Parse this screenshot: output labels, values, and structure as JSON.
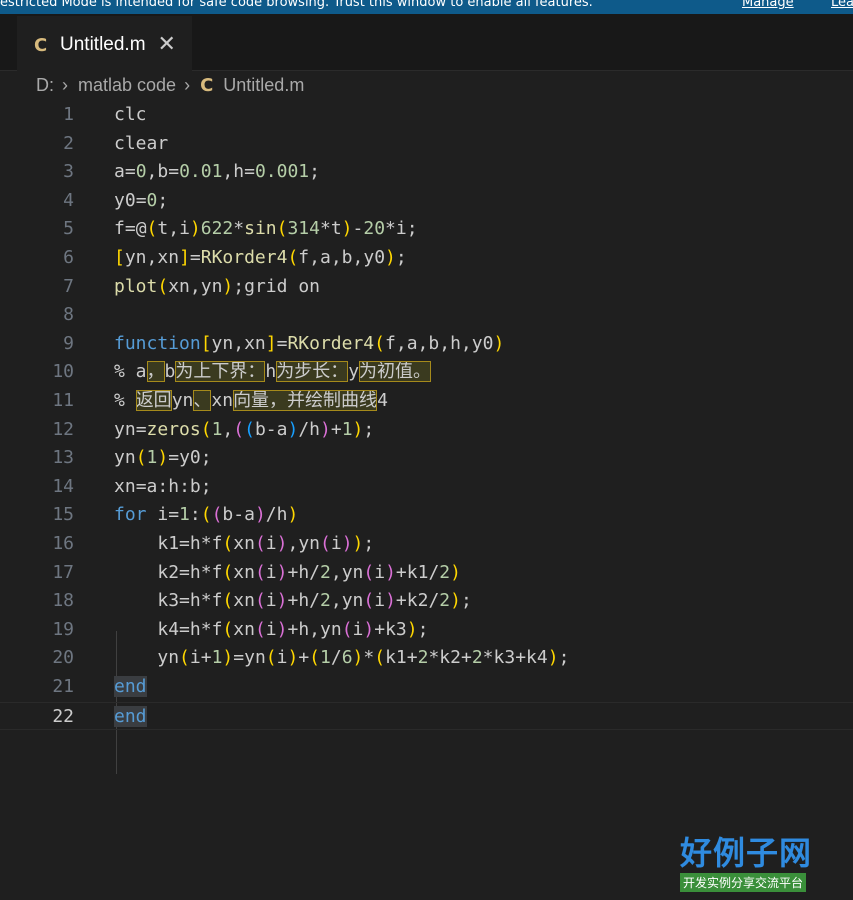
{
  "banner": {
    "text": "estricted Mode is intended for safe code browsing. Trust this window to enable all features.",
    "manage": "Manage",
    "learn": "Lea"
  },
  "tab": {
    "icon": "C",
    "name": "Untitled.m",
    "close": "✕"
  },
  "breadcrumb": {
    "drive": "D:",
    "folder": "matlab code",
    "file_icon": "C",
    "file": "Untitled.m"
  },
  "editor": {
    "lines": [
      {
        "n": "1",
        "text": "clc"
      },
      {
        "n": "2",
        "text": "clear"
      },
      {
        "n": "3",
        "text": "a=0,b=0.01,h=0.001;"
      },
      {
        "n": "4",
        "text": "y0=0;"
      },
      {
        "n": "5",
        "text": "f=@(t,i)622*sin(314*t)-20*i;"
      },
      {
        "n": "6",
        "text": "[yn,xn]=RKorder4(f,a,b,y0);"
      },
      {
        "n": "7",
        "text": "plot(xn,yn);grid on"
      },
      {
        "n": "8",
        "text": ""
      },
      {
        "n": "9",
        "text": "function[yn,xn]=RKorder4(f,a,b,h,y0)"
      },
      {
        "n": "10",
        "text": "% a，b为上下界：h为步长：y为初值。"
      },
      {
        "n": "11",
        "text": "% 返回yn、xn向量，并绘制曲线4"
      },
      {
        "n": "12",
        "text": "yn=zeros(1,((b-a)/h)+1);"
      },
      {
        "n": "13",
        "text": "yn(1)=y0;"
      },
      {
        "n": "14",
        "text": "xn=a:h:b;"
      },
      {
        "n": "15",
        "text": "for i=1:((b-a)/h)"
      },
      {
        "n": "16",
        "text": "    k1=h*f(xn(i),yn(i));"
      },
      {
        "n": "17",
        "text": "    k2=h*f(xn(i)+h/2,yn(i)+k1/2)"
      },
      {
        "n": "18",
        "text": "    k3=h*f(xn(i)+h/2,yn(i)+k2/2);"
      },
      {
        "n": "19",
        "text": "    k4=h*f(xn(i)+h,yn(i)+k3);"
      },
      {
        "n": "20",
        "text": "    yn(i+1)=yn(i)+(1/6)*(k1+2*k2+2*k3+k4);"
      },
      {
        "n": "21",
        "text": "end"
      },
      {
        "n": "22",
        "text": "end"
      }
    ],
    "current_line": "22"
  },
  "watermark": {
    "logo_text": "好例子网",
    "tagline": "开发实例分享交流平台"
  },
  "colors": {
    "accent_banner": "#0e5a8a",
    "c_icon": "#d7ba7d",
    "keyword": "#569cd6",
    "function": "#dcdcaa",
    "number": "#b5cea8"
  }
}
